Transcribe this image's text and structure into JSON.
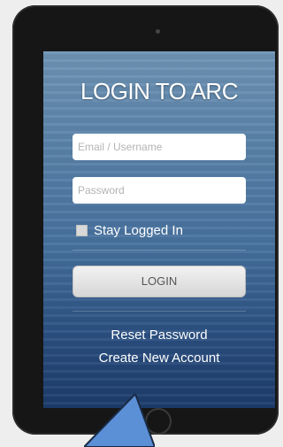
{
  "login": {
    "title": "LOGIN TO ARC",
    "email_placeholder": "Email / Username",
    "password_placeholder": "Password",
    "stay_logged_in": "Stay Logged In",
    "login_button": "LOGIN",
    "reset_password": "Reset Password",
    "create_account": "Create New Account"
  },
  "colors": {
    "screen_top": "#6f94b5",
    "screen_bottom": "#1c3b6a",
    "arrow": "#5b8fd6"
  },
  "overlay": {
    "icon": "pointer-arrow-icon"
  }
}
